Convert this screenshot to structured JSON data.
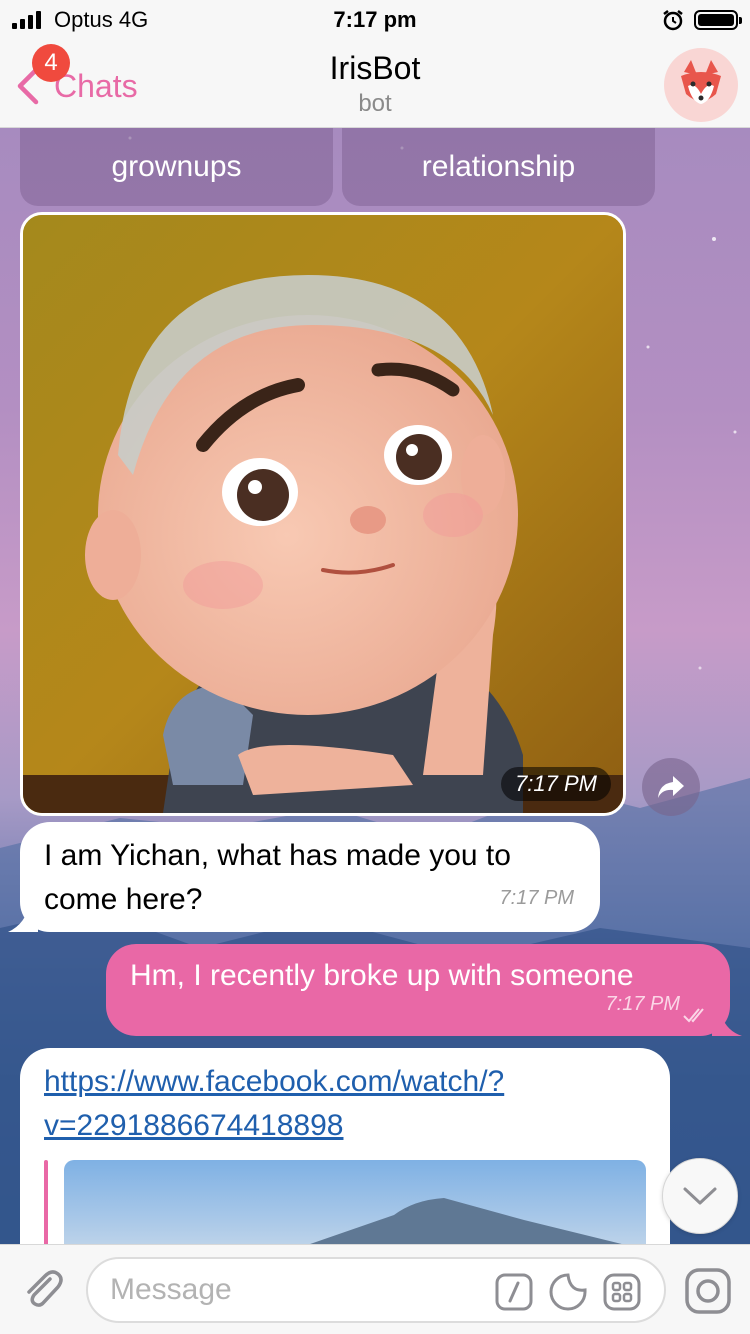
{
  "status_bar": {
    "carrier": "Optus",
    "network": "4G",
    "time": "7:17 pm"
  },
  "nav": {
    "back_label": "Chats",
    "unread_badge": "4",
    "title": "IrisBot",
    "subtitle": "bot"
  },
  "keyboard_buttons": [
    "grownups",
    "relationship"
  ],
  "messages": [
    {
      "type": "photo",
      "direction": "in",
      "time": "7:17 PM"
    },
    {
      "type": "text",
      "direction": "in",
      "lines": [
        "I am Yichan, what has made you to",
        "come here?"
      ],
      "time": "7:17 PM"
    },
    {
      "type": "text",
      "direction": "out",
      "text": "Hm, I recently broke up with someone",
      "time": "7:17 PM",
      "status": "read"
    },
    {
      "type": "link",
      "direction": "in",
      "lines": [
        "https://www.facebook.com/watch/?",
        "v=2291886674418898"
      ]
    }
  ],
  "input": {
    "placeholder": "Message"
  },
  "colors": {
    "accent": "#e968a6",
    "badge": "#f04a3e",
    "link": "#1f5fad"
  },
  "icons": [
    "signal-icon",
    "alarm-icon",
    "battery-icon",
    "back-chevron-icon",
    "fox-avatar-icon",
    "share-icon",
    "chevron-down-icon",
    "paperclip-icon",
    "command-icon",
    "sticker-icon",
    "bot-keyboard-icon",
    "camera-icon"
  ]
}
